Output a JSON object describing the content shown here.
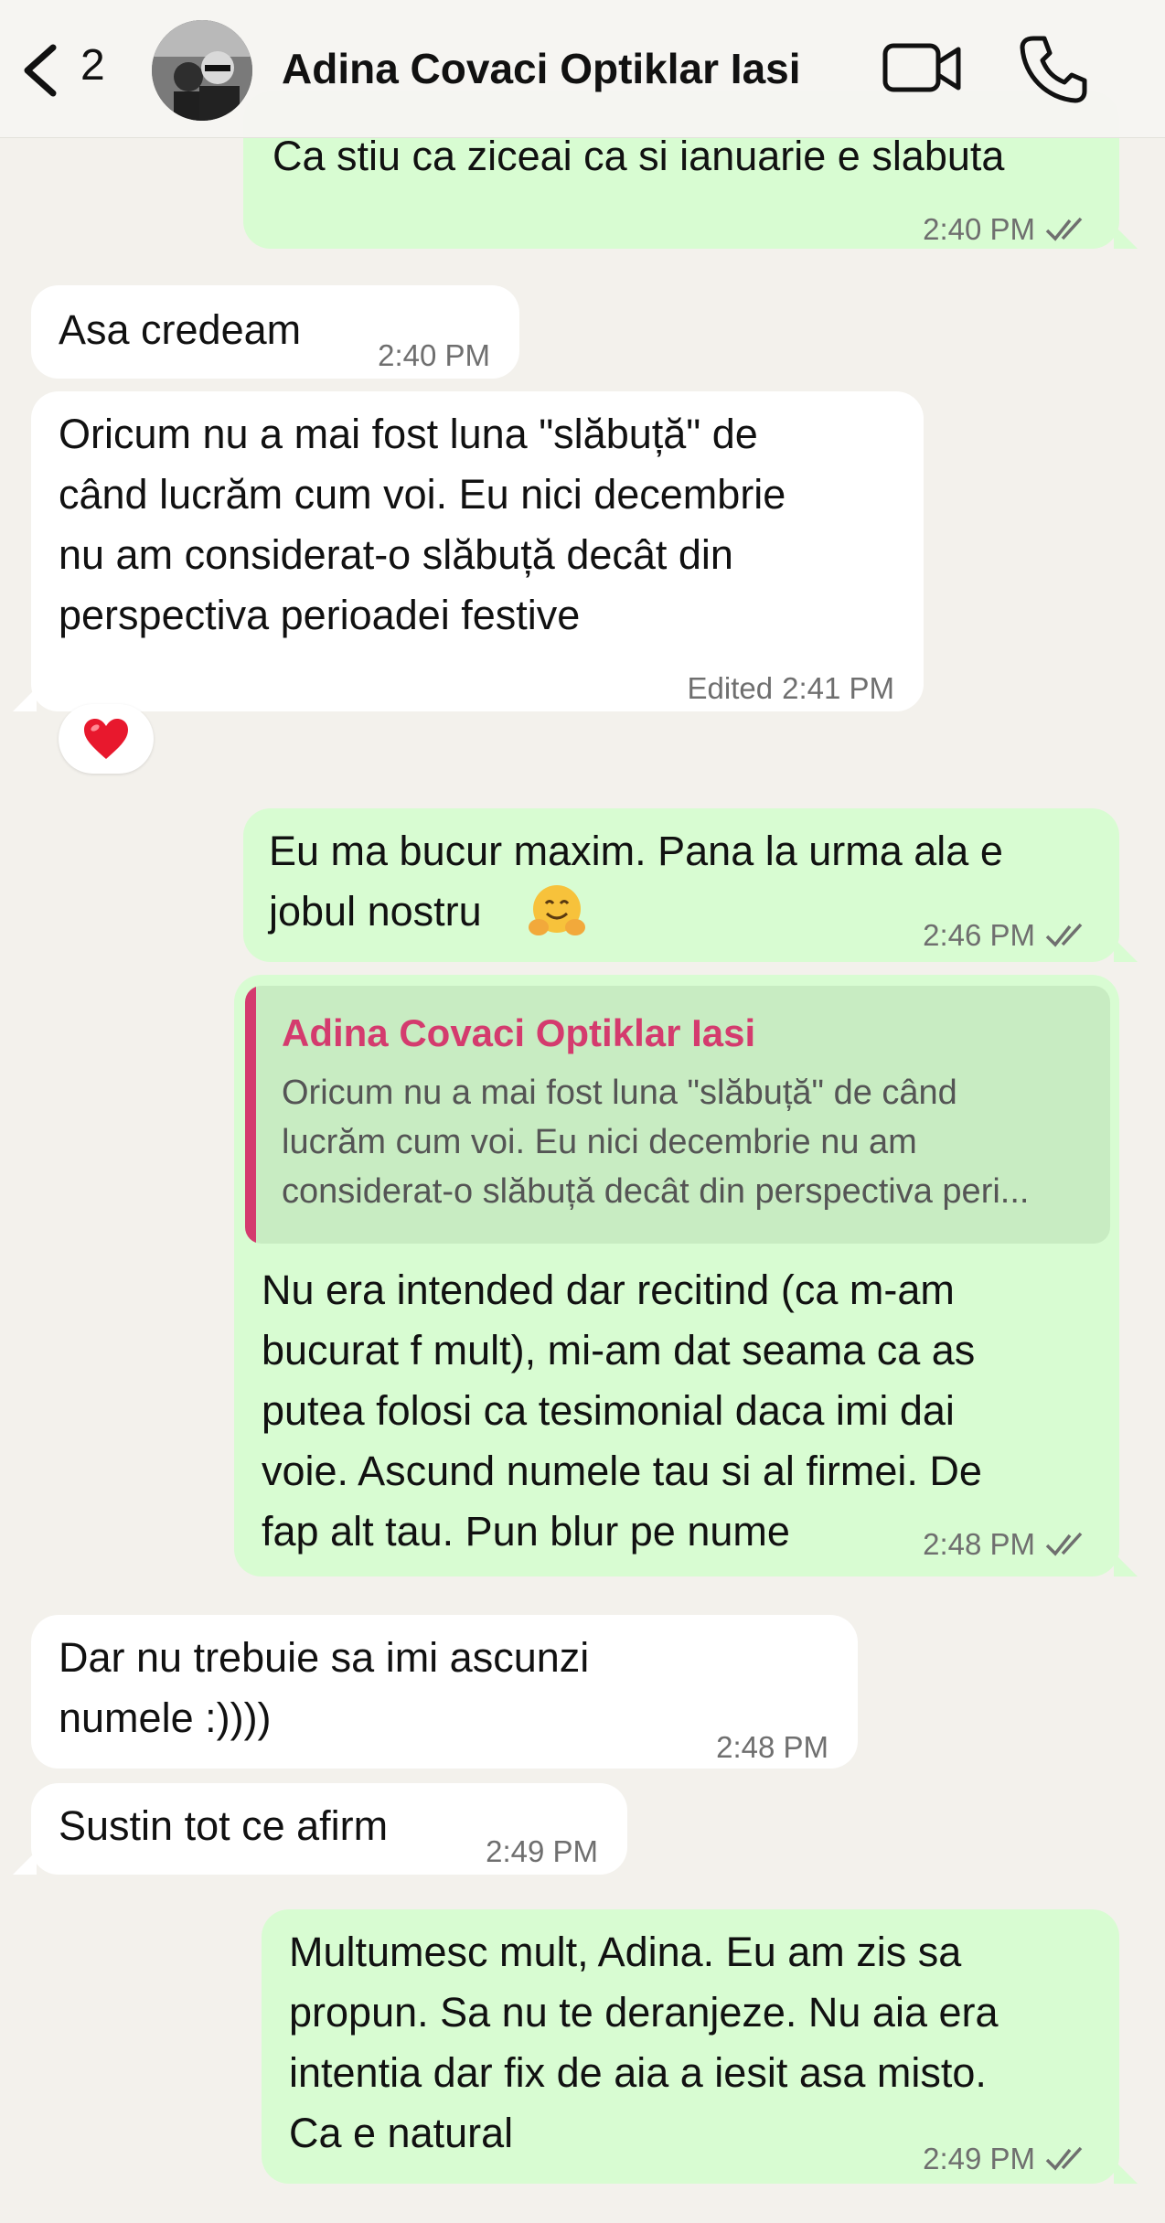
{
  "header": {
    "back_count": "2",
    "contact_name": "Adina Covaci Optiklar Iasi"
  },
  "colors": {
    "outgoing_bubble": "#d8fcd2",
    "incoming_bubble": "#ffffff",
    "quote_accent": "#d43b6e",
    "background": "#f3f1ec"
  },
  "messages": [
    {
      "direction": "out",
      "text": "Ca stiu ca ziceai ca si ianuarie e slabuta",
      "time": "2:40 PM",
      "status": "read"
    },
    {
      "direction": "in",
      "text": "Asa credeam",
      "time": "2:40 PM"
    },
    {
      "direction": "in",
      "text": "Oricum nu a mai fost luna \"slăbuță\" de\ncând lucrăm cum voi. Eu nici decembrie\nnu am considerat-o slăbuță decât din\nperspectiva perioadei festive",
      "edited": "Edited",
      "time": "2:41 PM",
      "reaction": "heart-emoji"
    },
    {
      "direction": "out",
      "text": "Eu ma bucur maxim. Pana la urma ala e\njobul nostru",
      "emoji": "hugging-face-emoji",
      "time": "2:46 PM",
      "status": "read"
    },
    {
      "direction": "out",
      "quote": {
        "author": "Adina Covaci Optiklar Iasi",
        "lines": [
          "Oricum nu a mai fost luna \"slăbuță\" de când",
          "lucrăm cum voi. Eu nici decembrie nu am",
          "considerat-o slăbuță decât din perspectiva peri..."
        ]
      },
      "text": "Nu era intended dar recitind (ca m-am\nbucurat f mult), mi-am dat seama ca as\nputea folosi ca tesimonial daca imi dai\nvoie. Ascund numele tau si al firmei. De\nfap alt tau. Pun blur pe nume",
      "time": "2:48 PM",
      "status": "read"
    },
    {
      "direction": "in",
      "text": "Dar nu trebuie sa imi ascunzi\nnumele :))))",
      "time": "2:48 PM"
    },
    {
      "direction": "in",
      "text": "Sustin tot ce afirm",
      "time": "2:49 PM"
    },
    {
      "direction": "out",
      "text": "Multumesc mult, Adina. Eu am zis sa\npropun. Sa nu te deranjeze. Nu aia era\nintentia dar fix de aia a iesit asa misto.\nCa e natural",
      "time": "2:49 PM",
      "status": "read"
    }
  ]
}
